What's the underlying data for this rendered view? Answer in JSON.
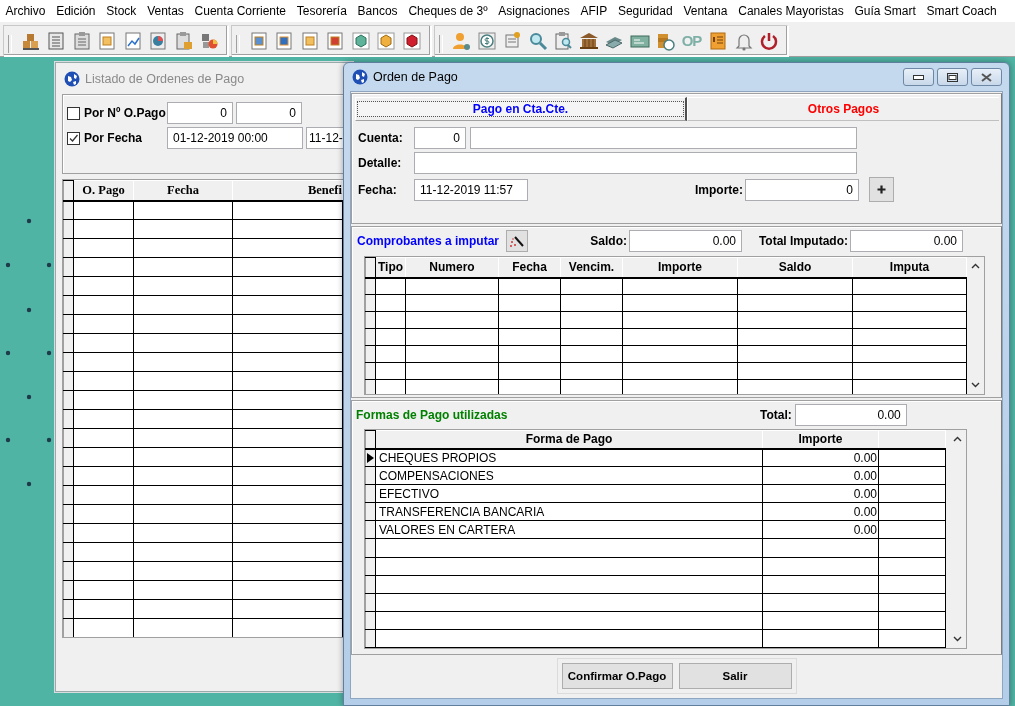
{
  "menu": [
    "Archivo",
    "Edición",
    "Stock",
    "Ventas",
    "Cuenta Corriente",
    "Tesorería",
    "Bancos",
    "Cheques de 3º",
    "Asignaciones",
    "AFIP",
    "Seguridad",
    "Ventana",
    "Canales Mayoristas",
    "Guía Smart",
    "Smart Coach"
  ],
  "toolbar": {
    "text_button": "OP"
  },
  "list_window": {
    "title": "Listado de Ordenes de Pago",
    "filters": [
      {
        "label": "Por Nº O.Pago",
        "checked": false,
        "kind": "number",
        "from": "0",
        "to": "0"
      },
      {
        "label": "Por Fecha",
        "checked": true,
        "kind": "date",
        "from": "01-12-2019 00:00",
        "to": "11-12-"
      }
    ],
    "table": {
      "columns": [
        "O. Pago",
        "Fecha",
        "Benefi"
      ]
    }
  },
  "dialog": {
    "title": "Orden de Pago",
    "tabs": [
      {
        "label": "Pago en Cta.Cte.",
        "selected": true,
        "color": "#0000ff"
      },
      {
        "label": "Otros Pagos",
        "selected": false,
        "color": "#ff0000"
      }
    ],
    "account": {
      "label": "Cuenta:",
      "code": "0"
    },
    "detail": {
      "label": "Detalle:"
    },
    "date": {
      "label": "Fecha:",
      "value": "11-12-2019 11:57"
    },
    "amount": {
      "label": "Importe:",
      "value": "0"
    },
    "vouchers": {
      "title": "Comprobantes a imputar",
      "balance": {
        "label": "Saldo:",
        "value": "0.00"
      },
      "total": {
        "label": "Total Imputado:",
        "value": "0.00"
      },
      "table": {
        "columns": [
          "Tipo",
          "Numero",
          "Fecha",
          "Vencim.",
          "Importe",
          "Saldo",
          "Imputa"
        ]
      }
    },
    "payment_methods": {
      "title": "Formas de Pago utilizadas",
      "total": {
        "label": "Total:",
        "value": "0.00"
      },
      "table": {
        "columns": [
          "Forma de Pago",
          "Importe"
        ],
        "rows": [
          {
            "method": "CHEQUES PROPIOS",
            "amount": "0.00",
            "selected": true
          },
          {
            "method": "COMPENSACIONES",
            "amount": "0.00",
            "selected": false
          },
          {
            "method": "EFECTIVO",
            "amount": "0.00",
            "selected": false
          },
          {
            "method": "TRANSFERENCIA BANCARIA",
            "amount": "0.00",
            "selected": false
          },
          {
            "method": "VALORES EN CARTERA",
            "amount": "0.00",
            "selected": false
          }
        ]
      }
    },
    "buttons": [
      "Confirmar O.Pago",
      "Salir"
    ]
  }
}
